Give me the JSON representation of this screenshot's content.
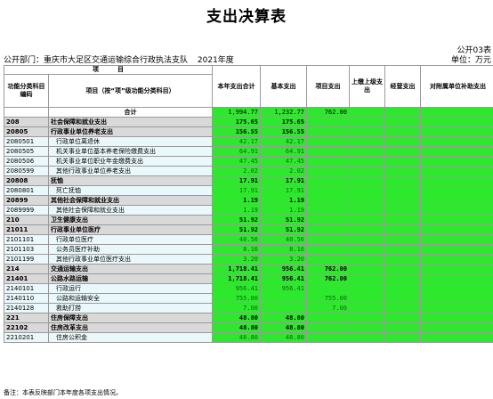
{
  "title": "支出决算表",
  "form_code": "公开03表",
  "department": "公开部门：重庆市大足区交通运输综合行政执法支队",
  "year": "2021年度",
  "unit": "单位：万元",
  "headers": {
    "group": "项　　　目",
    "code": "功能分类科目编码",
    "name": "项目（按“项”级功能分类科目）",
    "total": "本年支出合计",
    "basic": "基本支出",
    "project": "项目支出",
    "upper": "上缴上级支出",
    "business": "经营支出",
    "subsidy": "对附属单位补助支出"
  },
  "rows": [
    {
      "code": "",
      "name": "合计",
      "total": "1,994.77",
      "basic": "1,232.77",
      "project": "762.00",
      "style": "total"
    },
    {
      "code": "208",
      "name": "社会保障和就业支出",
      "total": "175.65",
      "basic": "175.65",
      "project": "",
      "style": "gray"
    },
    {
      "code": "20805",
      "name": "行政事业单位养老支出",
      "total": "156.55",
      "basic": "156.55",
      "project": "",
      "style": "gray"
    },
    {
      "code": "2080501",
      "name": "行政单位离退休",
      "total": "42.17",
      "basic": "42.17",
      "project": "",
      "style": "leaf"
    },
    {
      "code": "2080505",
      "name": "机关事业单位基本养老保险缴费支出",
      "total": "64.91",
      "basic": "64.91",
      "project": "",
      "style": "leaf"
    },
    {
      "code": "2080506",
      "name": "机关事业单位职业年金缴费支出",
      "total": "47.45",
      "basic": "47.45",
      "project": "",
      "style": "leaf"
    },
    {
      "code": "2080599",
      "name": "其他行政事业单位养老支出",
      "total": "2.02",
      "basic": "2.02",
      "project": "",
      "style": "leaf"
    },
    {
      "code": "20808",
      "name": "抚恤",
      "total": "17.91",
      "basic": "17.91",
      "project": "",
      "style": "gray"
    },
    {
      "code": "2080801",
      "name": "死亡抚恤",
      "total": "17.91",
      "basic": "17.91",
      "project": "",
      "style": "leaf"
    },
    {
      "code": "20899",
      "name": "其他社会保障和就业支出",
      "total": "1.19",
      "basic": "1.19",
      "project": "",
      "style": "gray"
    },
    {
      "code": "2089999",
      "name": "其他社会保障和就业支出",
      "total": "1.19",
      "basic": "1.19",
      "project": "",
      "style": "leaf"
    },
    {
      "code": "210",
      "name": "卫生健康支出",
      "total": "51.92",
      "basic": "51.92",
      "project": "",
      "style": "gray"
    },
    {
      "code": "21011",
      "name": "行政事业单位医疗",
      "total": "51.92",
      "basic": "51.92",
      "project": "",
      "style": "gray"
    },
    {
      "code": "2101101",
      "name": "行政单位医疗",
      "total": "40.56",
      "basic": "40.56",
      "project": "",
      "style": "leaf"
    },
    {
      "code": "2101103",
      "name": "公务员医疗补助",
      "total": "8.16",
      "basic": "8.16",
      "project": "",
      "style": "leaf"
    },
    {
      "code": "2101199",
      "name": "其他行政事业单位医疗支出",
      "total": "3.20",
      "basic": "3.20",
      "project": "",
      "style": "leaf"
    },
    {
      "code": "214",
      "name": "交通运输支出",
      "total": "1,718.41",
      "basic": "956.41",
      "project": "762.00",
      "style": "gray"
    },
    {
      "code": "21401",
      "name": "公路水路运输",
      "total": "1,718.41",
      "basic": "956.41",
      "project": "762.00",
      "style": "gray"
    },
    {
      "code": "2140101",
      "name": "行政运行",
      "total": "956.41",
      "basic": "956.41",
      "project": "",
      "style": "leaf"
    },
    {
      "code": "2140110",
      "name": "公路和运输安全",
      "total": "755.00",
      "basic": "",
      "project": "755.00",
      "style": "leaf"
    },
    {
      "code": "2140128",
      "name": "救助打捞",
      "total": "7.00",
      "basic": "",
      "project": "7.00",
      "style": "leaf"
    },
    {
      "code": "221",
      "name": "住房保障支出",
      "total": "48.80",
      "basic": "48.80",
      "project": "",
      "style": "gray"
    },
    {
      "code": "22102",
      "name": "住房改革支出",
      "total": "48.80",
      "basic": "48.80",
      "project": "",
      "style": "gray"
    },
    {
      "code": "2210201",
      "name": "住房公积金",
      "total": "48.80",
      "basic": "48.80",
      "project": "",
      "style": "leaf"
    }
  ],
  "note": "备注：本表反映部门本年度各项支出情况。"
}
